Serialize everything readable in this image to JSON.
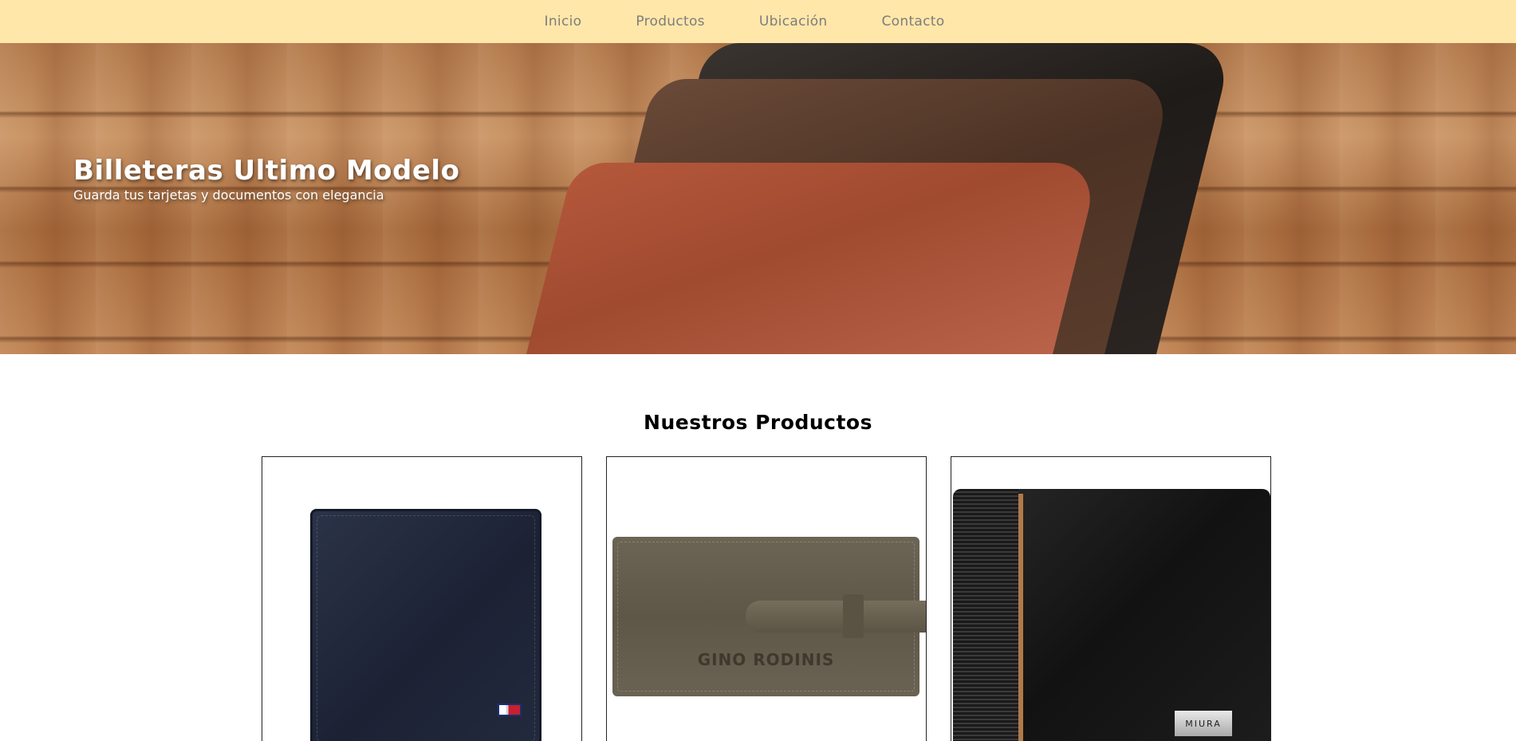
{
  "nav": {
    "items": [
      {
        "label": "Inicio"
      },
      {
        "label": "Productos"
      },
      {
        "label": "Ubicación"
      },
      {
        "label": "Contacto"
      }
    ]
  },
  "hero": {
    "title": "Billeteras Ultimo Modelo",
    "subtitle": "Guarda tus tarjetas y documentos con elegancia"
  },
  "products": {
    "section_title": "Nuestros Productos",
    "items": [
      {
        "image": "navy-bifold-wallet-image",
        "plate": ""
      },
      {
        "image": "olive-strap-wallet-image",
        "brand": "GINO RODINIS"
      },
      {
        "image": "black-leather-wallet-image",
        "plate": "MIURA"
      }
    ]
  },
  "colors": {
    "nav_background": "#ffe7a9",
    "nav_text": "#7d7d7d"
  }
}
